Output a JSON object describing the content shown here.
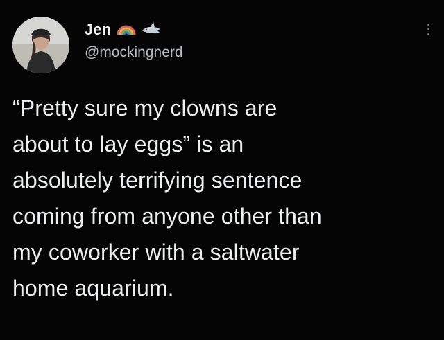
{
  "user": {
    "display_name": "Jen",
    "handle": "@mockingnerd",
    "badges": [
      "rainbow-icon",
      "shark-icon"
    ]
  },
  "tweet": {
    "lines": [
      "“Pretty sure my clowns are",
      "about to lay eggs” is an",
      "absolutely terrifying sentence",
      "coming from anyone other than",
      "my coworker with a saltwater",
      "home aquarium."
    ]
  },
  "colors": {
    "background": "#050505",
    "text": "#eceeef",
    "secondary_text": "#b8bcc0"
  }
}
